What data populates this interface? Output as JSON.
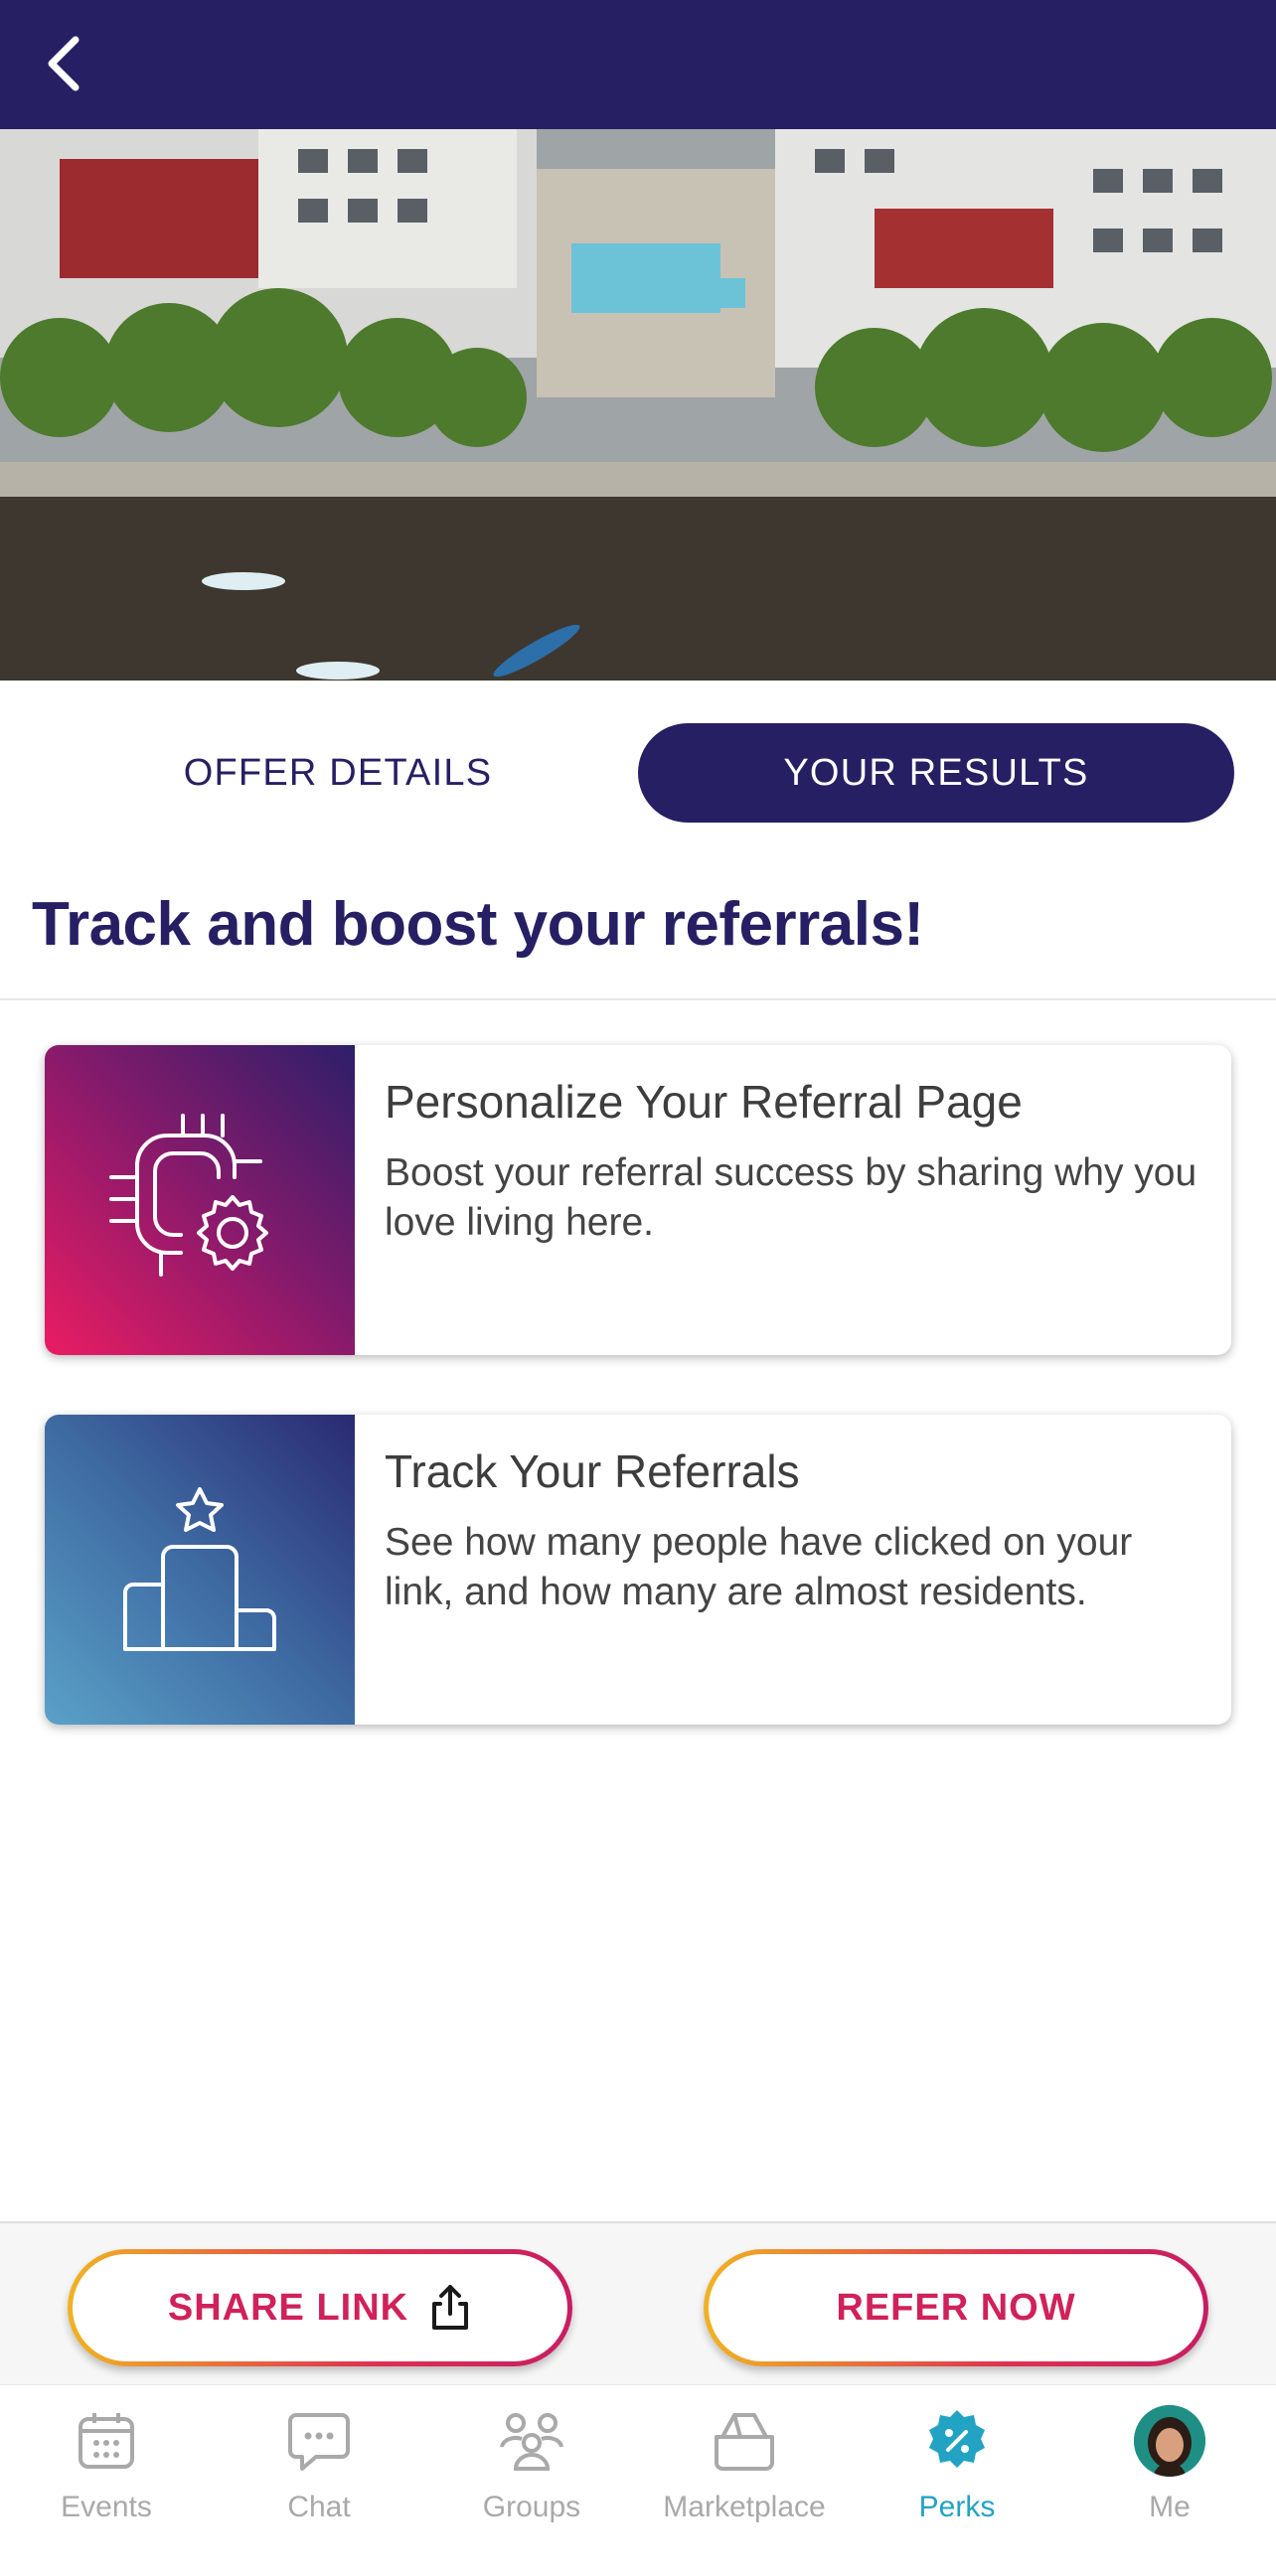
{
  "header": {
    "back_icon": "chevron-left-icon"
  },
  "tabs": {
    "offer_details": "OFFER DETAILS",
    "your_results": "YOUR RESULTS",
    "active": "your_results"
  },
  "headline": "Track and boost your referrals!",
  "cards": [
    {
      "title": "Personalize Your Referral Page",
      "description": "Boost your referral success by sharing why you love living here.",
      "icon": "personalize-gear-icon"
    },
    {
      "title": "Track Your Referrals",
      "description": "See how many people have clicked on your link, and how many are almost residents.",
      "icon": "podium-star-icon"
    }
  ],
  "actions": {
    "share_label": "SHARE LINK",
    "share_icon": "share-icon",
    "refer_label": "REFER NOW"
  },
  "nav": [
    {
      "label": "Events",
      "icon": "calendar-icon"
    },
    {
      "label": "Chat",
      "icon": "chat-bubble-icon"
    },
    {
      "label": "Groups",
      "icon": "groups-icon"
    },
    {
      "label": "Marketplace",
      "icon": "marketplace-bag-icon"
    },
    {
      "label": "Perks",
      "icon": "perks-badge-icon",
      "active": true
    },
    {
      "label": "Me",
      "icon": "avatar"
    }
  ],
  "colors": {
    "brand_navy": "#271f63",
    "accent_pink": "#d0215a",
    "accent_teal": "#22a3c4"
  }
}
